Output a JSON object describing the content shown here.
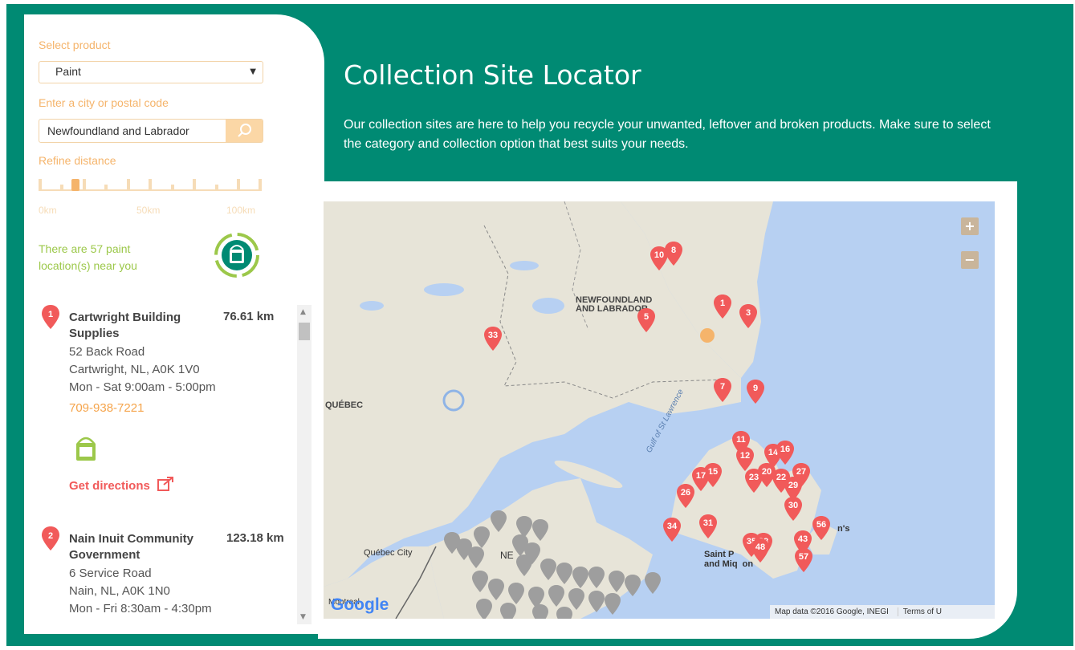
{
  "sidebar": {
    "product_label": "Select product",
    "product_value": "Paint",
    "location_label": "Enter a city or postal code",
    "location_value": "Newfoundland and Labrador",
    "distance_label": "Refine distance",
    "distance_ticks": [
      "0km",
      "50km",
      "100km"
    ],
    "count_text": "There are 57 paint location(s) near you",
    "colors": {
      "accent": "#f5b46b",
      "green": "#9cc84a",
      "red": "#f15a5a"
    }
  },
  "locations": [
    {
      "number": "1",
      "name": "Cartwright Building Supplies",
      "distance": "76.61 km",
      "address": [
        "52 Back Road",
        "Cartwright, NL, A0K 1V0",
        "Mon - Sat 9:00am - 5:00pm"
      ],
      "phone": "709-938-7221",
      "directions": "Get directions"
    },
    {
      "number": "2",
      "name": "Nain Inuit Community Government",
      "distance": "123.18 km",
      "address": [
        "6 Service Road",
        "Nain, NL, A0K 1N0",
        "Mon - Fri 8:30am - 4:30pm"
      ],
      "phone": "",
      "directions": ""
    }
  ],
  "header": {
    "title": "Collection Site Locator",
    "intro": "Our collection sites are here to help you recycle your unwanted, leftover and broken products. Make sure to select the category and collection option that best suits your needs."
  },
  "map": {
    "labels": {
      "nl": "NEWFOUNDLAND\nAND LABRADOR",
      "quebec": "QUÉBEC",
      "gulf": "Gulf of St Lawrence",
      "quebec_city": "Québec City",
      "saint_pierre": "Saint P\nand Miq  on",
      "st_johns": "n's",
      "ne": "NE",
      "montreal": "Montreal"
    },
    "markers": [
      "10",
      "8",
      "1",
      "3",
      "5",
      "33",
      "7",
      "9",
      "11",
      "12",
      "14",
      "16",
      "15",
      "17",
      "23",
      "20",
      "22",
      "27",
      "29",
      "26",
      "30",
      "34",
      "31",
      "35",
      "38",
      "48",
      "43",
      "57",
      "56"
    ],
    "zoom_in": "+",
    "zoom_out": "−",
    "attribution": "Map data ©2016 Google, INEGI",
    "terms": "Terms of U",
    "google": "Google"
  }
}
